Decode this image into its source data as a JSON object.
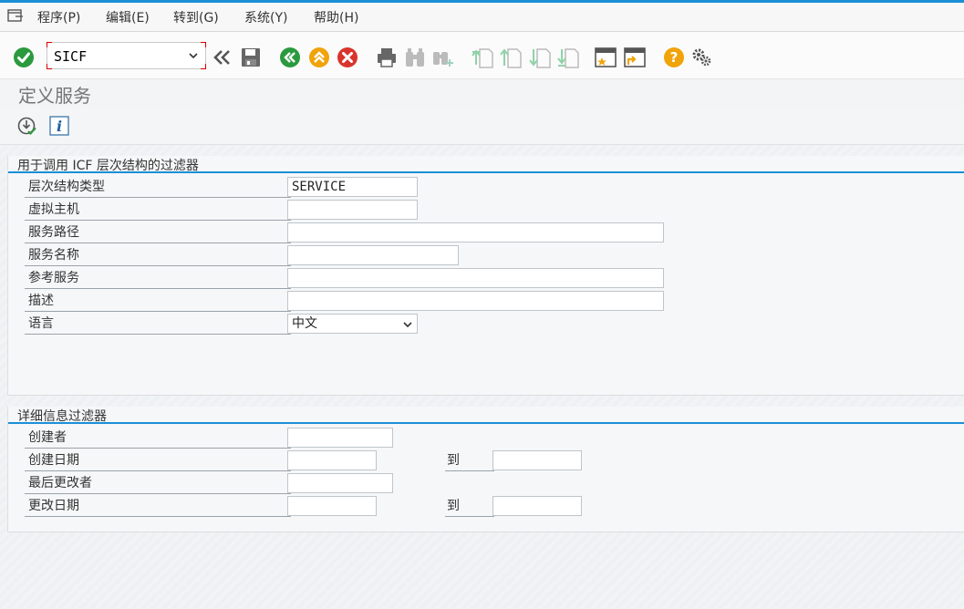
{
  "menubar": {
    "items": [
      "程序(P)",
      "编辑(E)",
      "转到(G)",
      "系统(Y)",
      "帮助(H)"
    ]
  },
  "toolbar": {
    "command_value": "SICF",
    "icons": [
      "check-icon",
      "back-double-icon",
      "save-icon",
      "back-icon",
      "exit-icon",
      "cancel-icon",
      "print-icon",
      "find-icon",
      "find-next-icon",
      "first-page-icon",
      "previous-page-icon",
      "next-page-icon",
      "last-page-icon",
      "new-session-icon",
      "create-shortcut-icon",
      "help-icon",
      "settings-icon"
    ]
  },
  "page": {
    "title": "定义服务"
  },
  "app_toolbar": {
    "icons": [
      "execute-icon",
      "info-icon"
    ]
  },
  "filter_icf": {
    "title": "用于调用 ICF 层次结构的过滤器",
    "fields": [
      {
        "label": "层次结构类型",
        "value": "SERVICE"
      },
      {
        "label": "虚拟主机",
        "value": ""
      },
      {
        "label": "服务路径",
        "value": ""
      },
      {
        "label": "服务名称",
        "value": ""
      },
      {
        "label": "参考服务",
        "value": ""
      },
      {
        "label": "描述",
        "value": ""
      },
      {
        "label": "语言",
        "value": "中文"
      }
    ]
  },
  "filter_detail": {
    "title": "详细信息过滤器",
    "fields": [
      {
        "label": "创建者",
        "value": ""
      },
      {
        "label": "创建日期",
        "value": "",
        "to_label": "到",
        "to_value": ""
      },
      {
        "label": "最后更改者",
        "value": ""
      },
      {
        "label": "更改日期",
        "value": "",
        "to_label": "到",
        "to_value": ""
      }
    ]
  },
  "colors": {
    "accent": "#1a8fd6",
    "green": "#2b9a3e",
    "orange": "#f0a30a",
    "red": "#d9342b"
  }
}
